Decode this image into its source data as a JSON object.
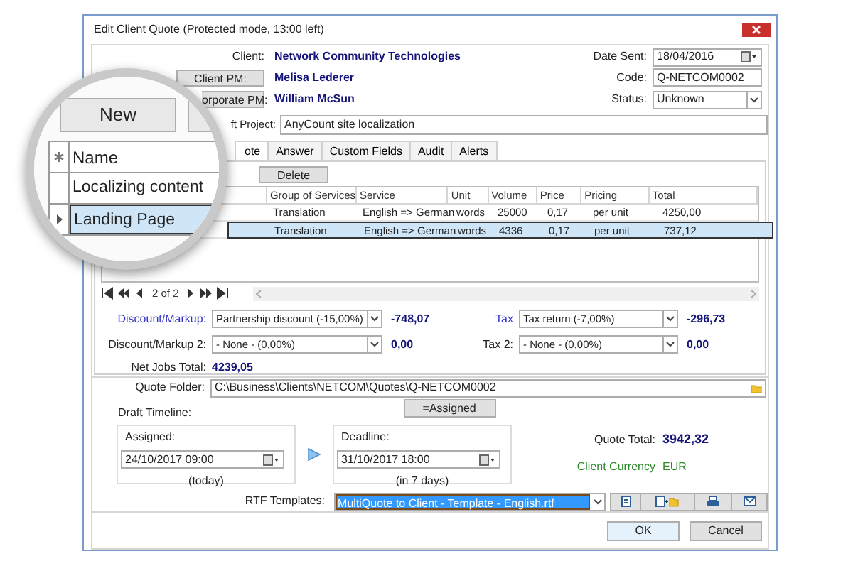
{
  "window": {
    "title": "Edit Client Quote (Protected mode, 13:00 left)"
  },
  "header": {
    "client_label": "Client:",
    "client": "Network Community Technologies",
    "client_pm_button": "Client PM:",
    "client_pm": "Melisa Lederer",
    "corporate_pm_button": "orporate PM:",
    "corporate_pm": "William McSun",
    "draft_project_label": "ft Project:",
    "draft_project": "AnyCount site localization",
    "date_sent_label": "Date Sent:",
    "date_sent": "18/04/2016",
    "code_label": "Code:",
    "code": "Q-NETCOM0002",
    "status_label": "Status:",
    "status": "Unknown"
  },
  "tabs": [
    {
      "label": "ote",
      "selected": true
    },
    {
      "label": "Answer",
      "selected": false
    },
    {
      "label": "Custom Fields",
      "selected": false
    },
    {
      "label": "Audit",
      "selected": false
    },
    {
      "label": "Alerts",
      "selected": false
    }
  ],
  "toolbar": {
    "delete_button": "Delete"
  },
  "table": {
    "columns": [
      "Group of Services",
      "Service",
      "Unit",
      "Volume",
      "Price",
      "Pricing",
      "Total"
    ],
    "rows": [
      {
        "cells": [
          "Translation",
          "English => German",
          "words",
          "25000",
          "0,17",
          "per unit",
          "4250,00"
        ],
        "selected": false
      },
      {
        "cells": [
          "Translation",
          "English => German",
          "words",
          "4336",
          "0,17",
          "per unit",
          "737,12"
        ],
        "selected": true
      }
    ]
  },
  "navigator": {
    "position": "2 of 2"
  },
  "adjustments": [
    {
      "label": "Discount/Markup:",
      "link": true,
      "value": "Partnership discount (-15,00%)",
      "amount": "-748,07"
    },
    {
      "label": "Tax",
      "link": true,
      "value": "Tax return (-7,00%)",
      "amount": "-296,73"
    },
    {
      "label": "Discount/Markup 2:",
      "link": false,
      "value": "- None - (0,00%)",
      "amount": "0,00"
    },
    {
      "label": "Tax 2:",
      "link": false,
      "value": "- None - (0,00%)",
      "amount": "0,00"
    }
  ],
  "net_jobs_total": {
    "label": "Net Jobs Total:",
    "value": "4239,05"
  },
  "quote_folder": {
    "label": "Quote Folder:",
    "value": "C:\\Business\\Clients\\NETCOM\\Quotes\\Q-NETCOM0002"
  },
  "timeline": {
    "label": "Draft Timeline:",
    "assigned_button": "=Assigned",
    "assigned": {
      "label": "Assigned:",
      "value": "24/10/2017 09:00",
      "note": "(today)"
    },
    "deadline": {
      "label": "Deadline:",
      "value": "31/10/2017 18:00",
      "note": "(in 7 days)"
    }
  },
  "totals": {
    "quote_total_label": "Quote Total:",
    "quote_total": "3942,32",
    "currency_label": "Client Currency",
    "currency": "EUR"
  },
  "rtf": {
    "label": "RTF Templates:",
    "value": "MultiQuote to Client - Template - English.rtf"
  },
  "buttons": [
    "OK",
    "Cancel"
  ],
  "magnifier": {
    "new_button": "New",
    "column": "Name",
    "rows": [
      {
        "name": "Localizing content",
        "selected": false
      },
      {
        "name": "Landing Page",
        "selected": true
      }
    ]
  }
}
